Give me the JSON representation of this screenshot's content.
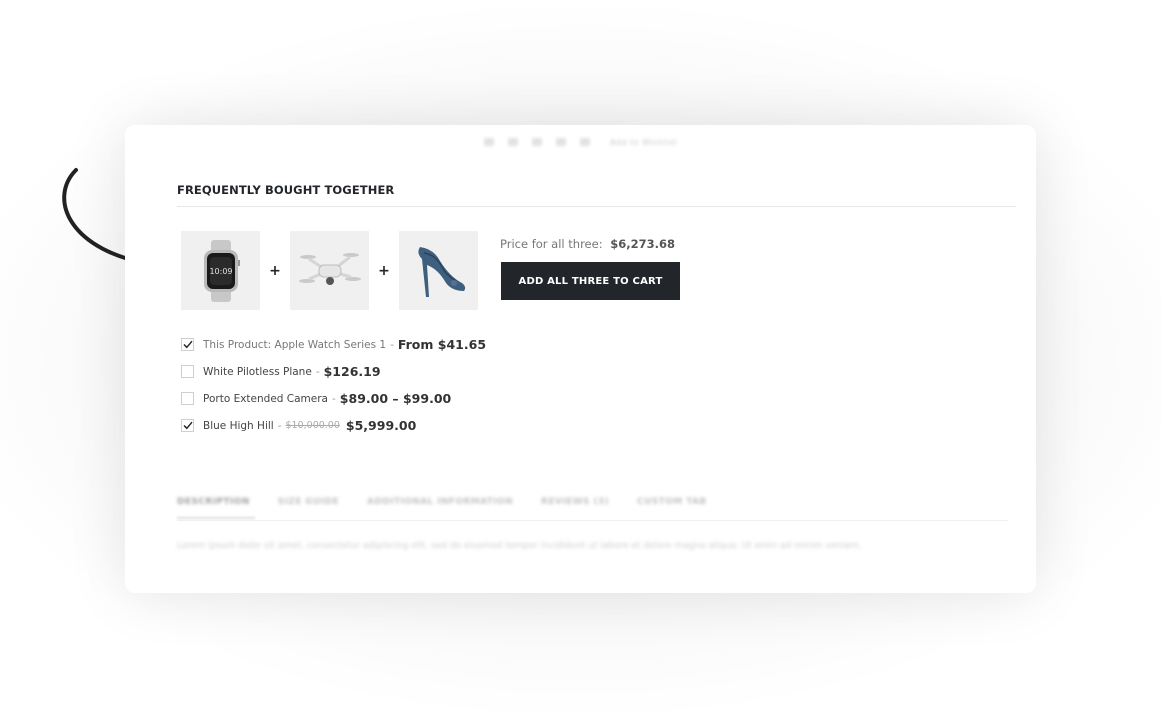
{
  "share": {
    "label": "Add to Wishlist"
  },
  "fbt": {
    "title": "FREQUENTLY BOUGHT TOGETHER",
    "products": [
      {
        "image": "smartwatch-image"
      },
      {
        "image": "drone-image"
      },
      {
        "image": "high-heel-shoe-image"
      }
    ],
    "plus": "+",
    "price_label": "Price for all three:",
    "price_total": "$6,273.68",
    "cart_button": "ADD ALL THREE TO CART"
  },
  "items": [
    {
      "checked": true,
      "name": "This Product: Apple Watch Series 1",
      "price": "From $41.65"
    },
    {
      "checked": false,
      "name": "White Pilotless Plane",
      "price": "$126.19"
    },
    {
      "checked": false,
      "name": "Porto Extended Camera",
      "price": "$89.00 – $99.00"
    },
    {
      "checked": true,
      "name": "Blue High Hill",
      "old_price": "$10,000.00",
      "price": "$5,999.00"
    }
  ],
  "separator": "-",
  "tabs": [
    "DESCRIPTION",
    "SIZE GUIDE",
    "ADDITIONAL INFORMATION",
    "REVIEWS (3)",
    "CUSTOM TAB"
  ],
  "description_text": "Lorem ipsum dolor sit amet, consectetur adipiscing elit, sed do eiusmod tempor incididunt ut labore et dolore magna aliqua. Ut enim ad minim veniam,",
  "colors": {
    "button_bg": "#222529",
    "thumb_bg": "#f0f0f0",
    "text_dark": "#222529"
  }
}
